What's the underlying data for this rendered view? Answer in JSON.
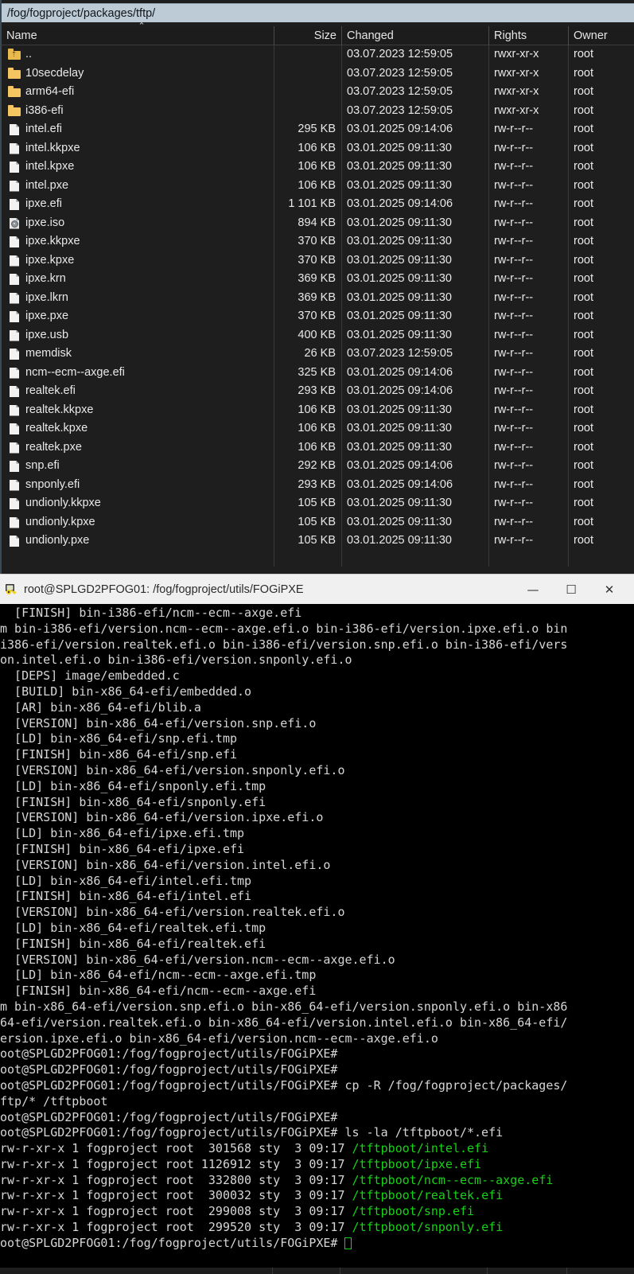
{
  "filemanager": {
    "path": "/fog/fogproject/packages/tftp/",
    "sort_indicator": "⌃",
    "columns": [
      {
        "key": "name",
        "label": "Name"
      },
      {
        "key": "size",
        "label": "Size"
      },
      {
        "key": "changed",
        "label": "Changed"
      },
      {
        "key": "rights",
        "label": "Rights"
      },
      {
        "key": "owner",
        "label": "Owner"
      }
    ],
    "rows": [
      {
        "icon": "folder-up-icon",
        "name": "..",
        "size": "",
        "changed": "03.07.2023 12:59:05",
        "rights": "rwxr-xr-x",
        "owner": "root"
      },
      {
        "icon": "folder-icon",
        "name": "10secdelay",
        "size": "",
        "changed": "03.07.2023 12:59:05",
        "rights": "rwxr-xr-x",
        "owner": "root"
      },
      {
        "icon": "folder-icon",
        "name": "arm64-efi",
        "size": "",
        "changed": "03.07.2023 12:59:05",
        "rights": "rwxr-xr-x",
        "owner": "root"
      },
      {
        "icon": "folder-icon",
        "name": "i386-efi",
        "size": "",
        "changed": "03.07.2023 12:59:05",
        "rights": "rwxr-xr-x",
        "owner": "root"
      },
      {
        "icon": "file-icon",
        "name": "intel.efi",
        "size": "295 KB",
        "changed": "03.01.2025 09:14:06",
        "rights": "rw-r--r--",
        "owner": "root"
      },
      {
        "icon": "file-icon",
        "name": "intel.kkpxe",
        "size": "106 KB",
        "changed": "03.01.2025 09:11:30",
        "rights": "rw-r--r--",
        "owner": "root"
      },
      {
        "icon": "file-icon",
        "name": "intel.kpxe",
        "size": "106 KB",
        "changed": "03.01.2025 09:11:30",
        "rights": "rw-r--r--",
        "owner": "root"
      },
      {
        "icon": "file-icon",
        "name": "intel.pxe",
        "size": "106 KB",
        "changed": "03.01.2025 09:11:30",
        "rights": "rw-r--r--",
        "owner": "root"
      },
      {
        "icon": "file-icon",
        "name": "ipxe.efi",
        "size": "1 101 KB",
        "changed": "03.01.2025 09:14:06",
        "rights": "rw-r--r--",
        "owner": "root"
      },
      {
        "icon": "disc-icon",
        "name": "ipxe.iso",
        "size": "894 KB",
        "changed": "03.01.2025 09:11:30",
        "rights": "rw-r--r--",
        "owner": "root"
      },
      {
        "icon": "file-icon",
        "name": "ipxe.kkpxe",
        "size": "370 KB",
        "changed": "03.01.2025 09:11:30",
        "rights": "rw-r--r--",
        "owner": "root"
      },
      {
        "icon": "file-icon",
        "name": "ipxe.kpxe",
        "size": "370 KB",
        "changed": "03.01.2025 09:11:30",
        "rights": "rw-r--r--",
        "owner": "root"
      },
      {
        "icon": "file-icon",
        "name": "ipxe.krn",
        "size": "369 KB",
        "changed": "03.01.2025 09:11:30",
        "rights": "rw-r--r--",
        "owner": "root"
      },
      {
        "icon": "file-icon",
        "name": "ipxe.lkrn",
        "size": "369 KB",
        "changed": "03.01.2025 09:11:30",
        "rights": "rw-r--r--",
        "owner": "root"
      },
      {
        "icon": "file-icon",
        "name": "ipxe.pxe",
        "size": "370 KB",
        "changed": "03.01.2025 09:11:30",
        "rights": "rw-r--r--",
        "owner": "root"
      },
      {
        "icon": "file-icon",
        "name": "ipxe.usb",
        "size": "400 KB",
        "changed": "03.01.2025 09:11:30",
        "rights": "rw-r--r--",
        "owner": "root"
      },
      {
        "icon": "file-icon",
        "name": "memdisk",
        "size": "26 KB",
        "changed": "03.07.2023 12:59:05",
        "rights": "rw-r--r--",
        "owner": "root"
      },
      {
        "icon": "file-icon",
        "name": "ncm--ecm--axge.efi",
        "size": "325 KB",
        "changed": "03.01.2025 09:14:06",
        "rights": "rw-r--r--",
        "owner": "root"
      },
      {
        "icon": "file-icon",
        "name": "realtek.efi",
        "size": "293 KB",
        "changed": "03.01.2025 09:14:06",
        "rights": "rw-r--r--",
        "owner": "root"
      },
      {
        "icon": "file-icon",
        "name": "realtek.kkpxe",
        "size": "106 KB",
        "changed": "03.01.2025 09:11:30",
        "rights": "rw-r--r--",
        "owner": "root"
      },
      {
        "icon": "file-icon",
        "name": "realtek.kpxe",
        "size": "106 KB",
        "changed": "03.01.2025 09:11:30",
        "rights": "rw-r--r--",
        "owner": "root"
      },
      {
        "icon": "file-icon",
        "name": "realtek.pxe",
        "size": "106 KB",
        "changed": "03.01.2025 09:11:30",
        "rights": "rw-r--r--",
        "owner": "root"
      },
      {
        "icon": "file-icon",
        "name": "snp.efi",
        "size": "292 KB",
        "changed": "03.01.2025 09:14:06",
        "rights": "rw-r--r--",
        "owner": "root"
      },
      {
        "icon": "file-icon",
        "name": "snponly.efi",
        "size": "293 KB",
        "changed": "03.01.2025 09:14:06",
        "rights": "rw-r--r--",
        "owner": "root"
      },
      {
        "icon": "file-icon",
        "name": "undionly.kkpxe",
        "size": "105 KB",
        "changed": "03.01.2025 09:11:30",
        "rights": "rw-r--r--",
        "owner": "root"
      },
      {
        "icon": "file-icon",
        "name": "undionly.kpxe",
        "size": "105 KB",
        "changed": "03.01.2025 09:11:30",
        "rights": "rw-r--r--",
        "owner": "root"
      },
      {
        "icon": "file-icon",
        "name": "undionly.pxe",
        "size": "105 KB",
        "changed": "03.01.2025 09:11:30",
        "rights": "rw-r--r--",
        "owner": "root"
      }
    ]
  },
  "terminal": {
    "title": "root@SPLGD2PFOG01: /fog/fogproject/utils/FOGiPXE",
    "title_icon": "putty-icon",
    "window_buttons": {
      "minimize": "—",
      "maximize": "☐",
      "close": "✕"
    },
    "prompt": "root@SPLGD2PFOG01:/fog/fogproject/utils/FOGiPXE#",
    "lines": [
      {
        "text": "  [FINISH] bin-i386-efi/ncm--ecm--axge.efi"
      },
      {
        "text": "m bin-i386-efi/version.ncm--ecm--axge.efi.o bin-i386-efi/version.ipxe.efi.o bin"
      },
      {
        "text": "i386-efi/version.realtek.efi.o bin-i386-efi/version.snp.efi.o bin-i386-efi/vers"
      },
      {
        "text": "on.intel.efi.o bin-i386-efi/version.snponly.efi.o"
      },
      {
        "text": "  [DEPS] image/embedded.c"
      },
      {
        "text": "  [BUILD] bin-x86_64-efi/embedded.o"
      },
      {
        "text": "  [AR] bin-x86_64-efi/blib.a"
      },
      {
        "text": "  [VERSION] bin-x86_64-efi/version.snp.efi.o"
      },
      {
        "text": "  [LD] bin-x86_64-efi/snp.efi.tmp"
      },
      {
        "text": "  [FINISH] bin-x86_64-efi/snp.efi"
      },
      {
        "text": "  [VERSION] bin-x86_64-efi/version.snponly.efi.o"
      },
      {
        "text": "  [LD] bin-x86_64-efi/snponly.efi.tmp"
      },
      {
        "text": "  [FINISH] bin-x86_64-efi/snponly.efi"
      },
      {
        "text": "  [VERSION] bin-x86_64-efi/version.ipxe.efi.o"
      },
      {
        "text": "  [LD] bin-x86_64-efi/ipxe.efi.tmp"
      },
      {
        "text": "  [FINISH] bin-x86_64-efi/ipxe.efi"
      },
      {
        "text": "  [VERSION] bin-x86_64-efi/version.intel.efi.o"
      },
      {
        "text": "  [LD] bin-x86_64-efi/intel.efi.tmp"
      },
      {
        "text": "  [FINISH] bin-x86_64-efi/intel.efi"
      },
      {
        "text": "  [VERSION] bin-x86_64-efi/version.realtek.efi.o"
      },
      {
        "text": "  [LD] bin-x86_64-efi/realtek.efi.tmp"
      },
      {
        "text": "  [FINISH] bin-x86_64-efi/realtek.efi"
      },
      {
        "text": "  [VERSION] bin-x86_64-efi/version.ncm--ecm--axge.efi.o"
      },
      {
        "text": "  [LD] bin-x86_64-efi/ncm--ecm--axge.efi.tmp"
      },
      {
        "text": "  [FINISH] bin-x86_64-efi/ncm--ecm--axge.efi"
      },
      {
        "text": "m bin-x86_64-efi/version.snp.efi.o bin-x86_64-efi/version.snponly.efi.o bin-x86"
      },
      {
        "text": "64-efi/version.realtek.efi.o bin-x86_64-efi/version.intel.efi.o bin-x86_64-efi/"
      },
      {
        "text": "ersion.ipxe.efi.o bin-x86_64-efi/version.ncm--ecm--axge.efi.o"
      },
      {
        "text": "oot@SPLGD2PFOG01:/fog/fogproject/utils/FOGiPXE#"
      },
      {
        "text": "oot@SPLGD2PFOG01:/fog/fogproject/utils/FOGiPXE#"
      },
      {
        "text": "oot@SPLGD2PFOG01:/fog/fogproject/utils/FOGiPXE# cp -R /fog/fogproject/packages/"
      },
      {
        "text": "ftp/* /tftpboot"
      },
      {
        "text": "oot@SPLGD2PFOG01:/fog/fogproject/utils/FOGiPXE#"
      },
      {
        "text": "oot@SPLGD2PFOG01:/fog/fogproject/utils/FOGiPXE# ls -la /tftpboot/*.efi"
      },
      {
        "text": "rw-r-xr-x 1 fogproject root  301568 sty  3 09:17 ",
        "green": "/tftpboot/intel.efi"
      },
      {
        "text": "rw-r-xr-x 1 fogproject root 1126912 sty  3 09:17 ",
        "green": "/tftpboot/ipxe.efi"
      },
      {
        "text": "rw-r-xr-x 1 fogproject root  332800 sty  3 09:17 ",
        "green": "/tftpboot/ncm--ecm--axge.efi"
      },
      {
        "text": "rw-r-xr-x 1 fogproject root  300032 sty  3 09:17 ",
        "green": "/tftpboot/realtek.efi"
      },
      {
        "text": "rw-r-xr-x 1 fogproject root  299008 sty  3 09:17 ",
        "green": "/tftpboot/snp.efi"
      },
      {
        "text": "rw-r-xr-x 1 fogproject root  299520 sty  3 09:17 ",
        "green": "/tftpboot/snponly.efi"
      },
      {
        "text": "oot@SPLGD2PFOG01:/fog/fogproject/utils/FOGiPXE# ",
        "cursor": true
      }
    ]
  },
  "colors": {
    "pathbar_bg": "#bdcbd6",
    "panel_bg": "#1e1e1e",
    "terminal_bg": "#000000",
    "terminal_fg": "#d6d6d6",
    "terminal_green": "#17d217",
    "folder_yellow": "#f5c562",
    "titlebar_bg": "#f0f0f0"
  }
}
